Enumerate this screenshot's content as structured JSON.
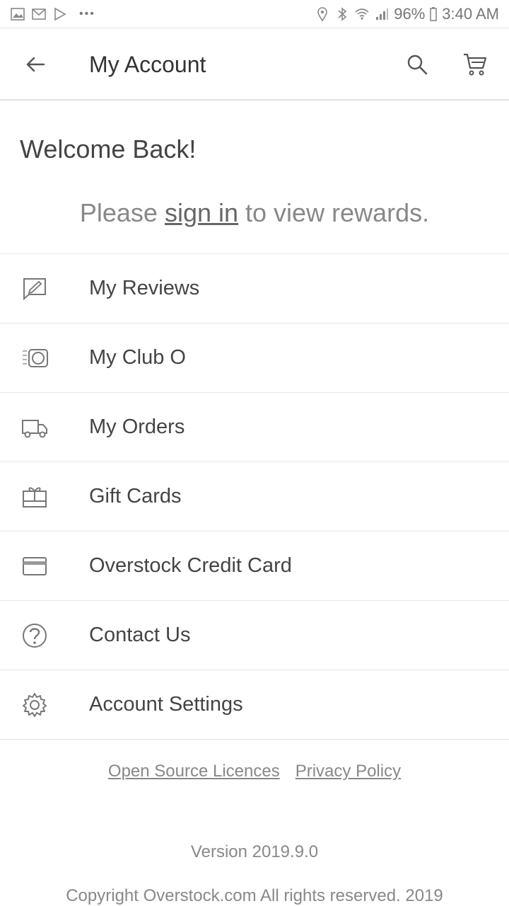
{
  "status_bar": {
    "left_icons": [
      "image-icon",
      "gmail-icon",
      "play-store-icon",
      "more-icon"
    ],
    "more_text": "•••",
    "battery": "96%",
    "time": "3:40 AM"
  },
  "header": {
    "title": "My Account",
    "icons": {
      "back": "back-arrow-icon",
      "search": "search-icon",
      "cart": "cart-icon"
    }
  },
  "welcome": {
    "title": "Welcome Back!",
    "prompt_before": "Please ",
    "prompt_link": "sign in",
    "prompt_after": " to view rewards."
  },
  "menu": {
    "items": [
      {
        "label": "My Reviews",
        "icon": "reviews-icon"
      },
      {
        "label": "My Club O",
        "icon": "club-o-icon"
      },
      {
        "label": "My Orders",
        "icon": "truck-icon"
      },
      {
        "label": "Gift Cards",
        "icon": "gift-card-icon"
      },
      {
        "label": "Overstock Credit Card",
        "icon": "credit-card-icon"
      },
      {
        "label": "Contact Us",
        "icon": "help-icon"
      },
      {
        "label": "Account Settings",
        "icon": "gear-icon"
      }
    ]
  },
  "footer": {
    "links": [
      "Open Source Licences",
      "Privacy Policy"
    ],
    "version": "Version 2019.9.0",
    "copyright": "Copyright Overstock.com All rights reserved. 2019"
  },
  "colors": {
    "text": "#444444",
    "muted": "#888888",
    "divider": "#e5e5e5"
  }
}
